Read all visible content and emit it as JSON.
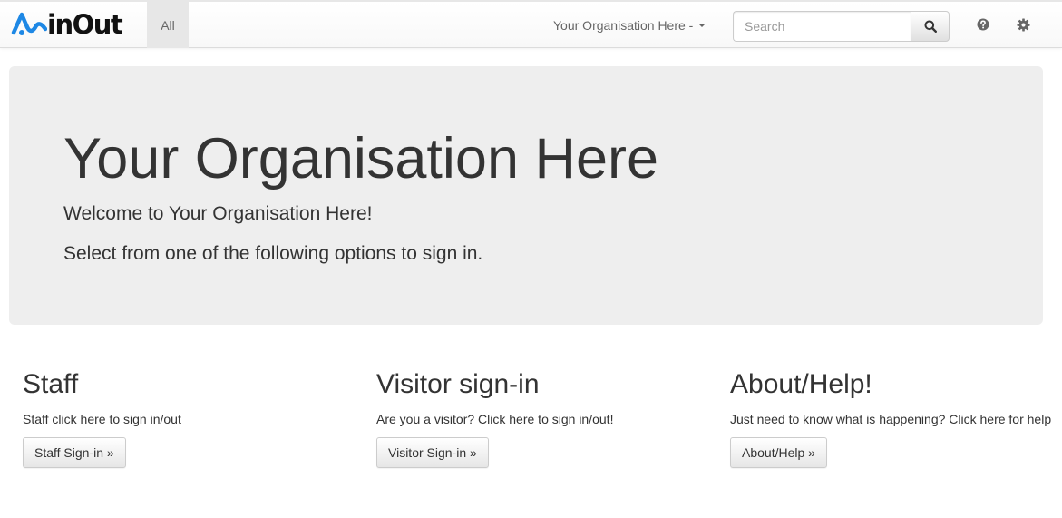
{
  "brand": {
    "name": "inOut",
    "logo_color": "#1e88e5"
  },
  "navbar": {
    "all_label": "All",
    "org_dropdown_label": "Your Organisation Here -",
    "search": {
      "placeholder": "Search",
      "value": ""
    },
    "icons": {
      "search": "search-icon",
      "help": "question-circle-icon",
      "settings": "gear-icon"
    }
  },
  "jumbotron": {
    "title": "Your Organisation Here",
    "welcome": "Welcome to Your Organisation Here!",
    "instruction": "Select from one of the following options to sign in."
  },
  "columns": [
    {
      "heading": "Staff",
      "text": "Staff click here to sign in/out",
      "button": "Staff Sign-in »"
    },
    {
      "heading": "Visitor sign-in",
      "text": "Are you a visitor? Click here to sign in/out!",
      "button": "Visitor Sign-in »"
    },
    {
      "heading": "About/Help!",
      "text": "Just need to know what is happening? Click here for help",
      "button": "About/Help »"
    }
  ],
  "colors": {
    "jumbotron_bg": "#eeeeee",
    "nav_active_bg": "#e7e7e7",
    "text": "#333333"
  }
}
